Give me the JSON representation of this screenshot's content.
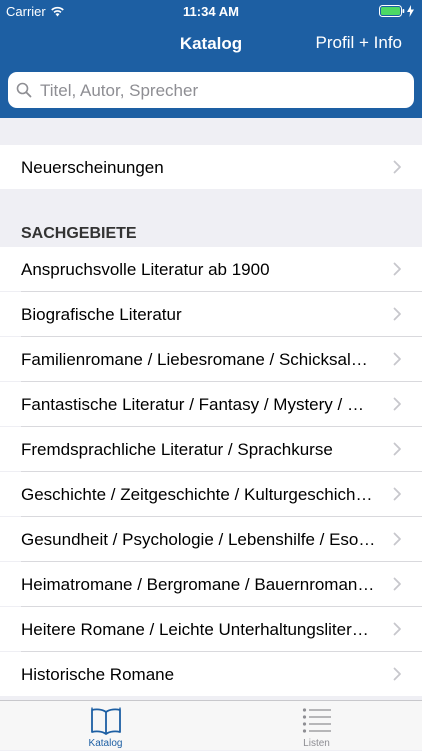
{
  "status_bar": {
    "carrier": "Carrier",
    "time": "11:34 AM"
  },
  "nav": {
    "title": "Katalog",
    "right_button": "Profil + Info"
  },
  "search": {
    "placeholder": "Titel, Autor, Sprecher"
  },
  "top_items": [
    {
      "label": "Neuerscheinungen"
    }
  ],
  "section": {
    "header": "SACHGEBIETE",
    "items": [
      {
        "label": "Anspruchsvolle Literatur ab 1900"
      },
      {
        "label": "Biografische Literatur"
      },
      {
        "label": "Familienromane / Liebesromane / Schicksals…"
      },
      {
        "label": "Fantastische Literatur / Fantasy / Mystery / H…"
      },
      {
        "label": "Fremdsprachliche Literatur / Sprachkurse"
      },
      {
        "label": "Geschichte / Zeitgeschichte / Kulturgeschich…"
      },
      {
        "label": "Gesundheit / Psychologie / Lebenshilfe / Eso…"
      },
      {
        "label": "Heimatromane / Bergromane / Bauernroman…"
      },
      {
        "label": "Heitere Romane / Leichte Unterhaltungsliter…"
      },
      {
        "label": "Historische Romane"
      }
    ]
  },
  "tabs": [
    {
      "label": "Katalog",
      "icon": "book-icon",
      "active": true
    },
    {
      "label": "Listen",
      "icon": "list-icon",
      "active": false
    }
  ],
  "colors": {
    "brand": "#1d5fa3",
    "active_tab": "#1d5fa3",
    "inactive_tab": "#8e8e93",
    "battery": "#4cd964"
  }
}
